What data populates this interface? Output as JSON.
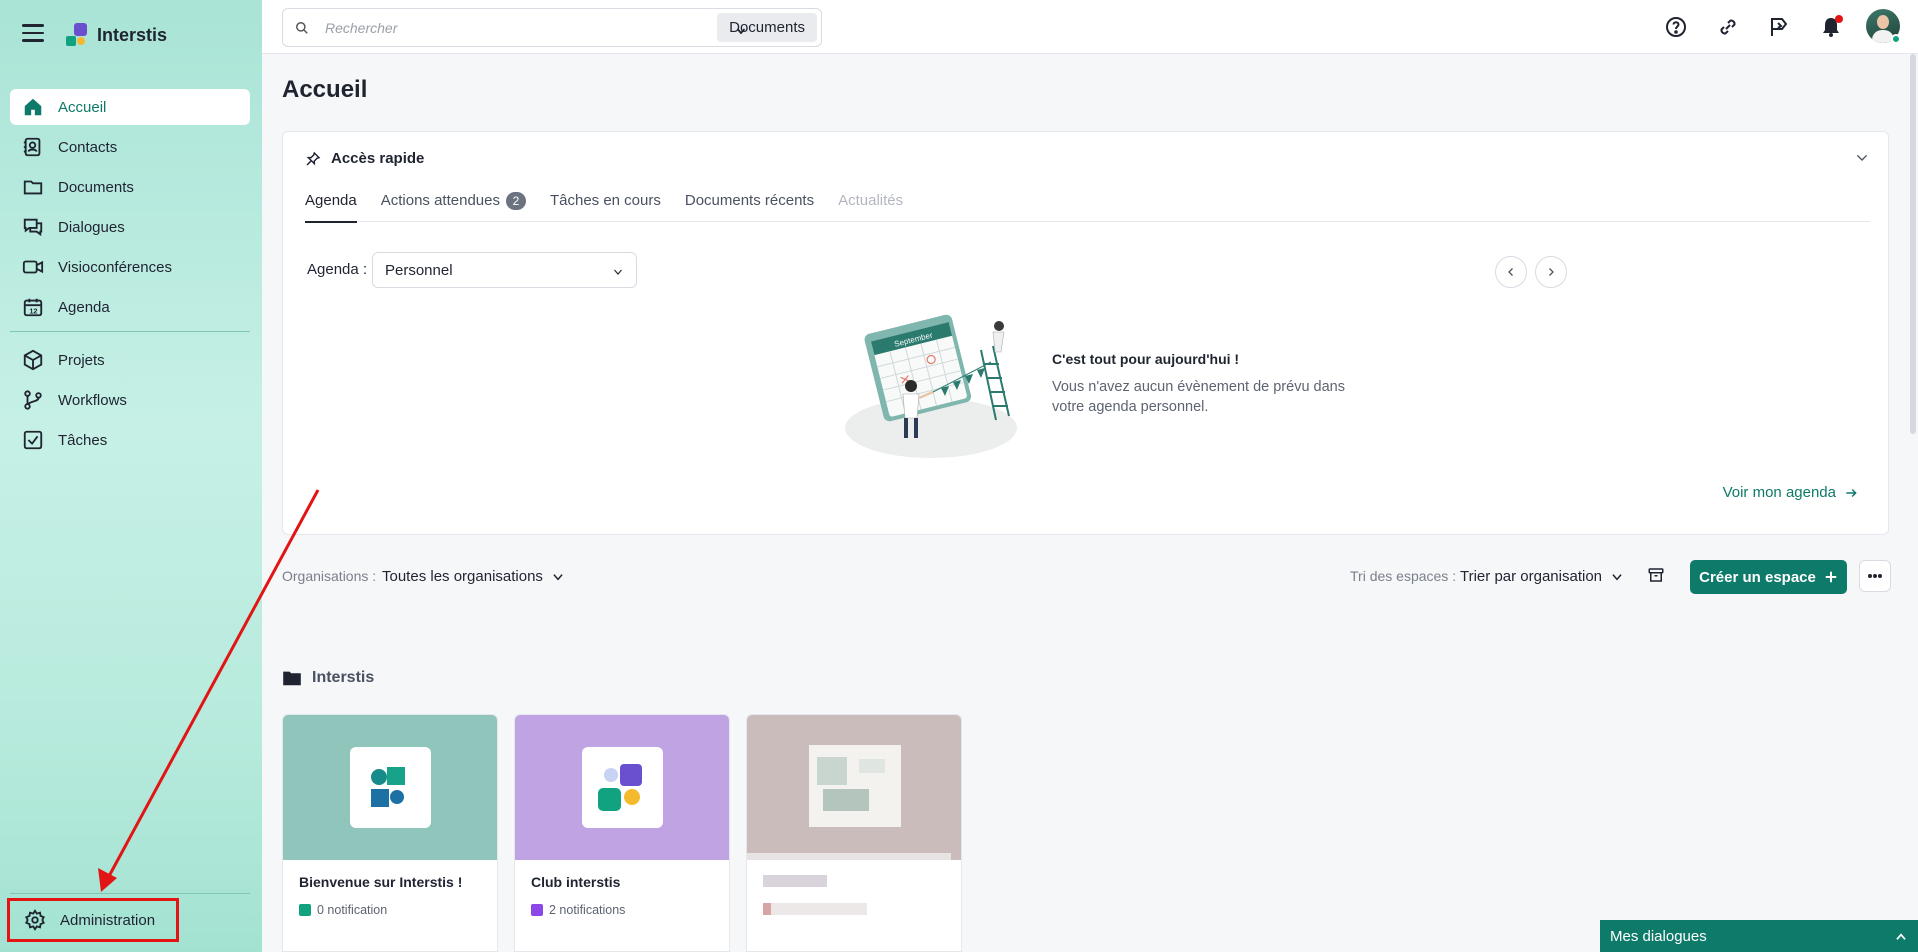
{
  "app": {
    "brand": "Interstis"
  },
  "sidebar": {
    "items": [
      {
        "label": "Accueil"
      },
      {
        "label": "Contacts"
      },
      {
        "label": "Documents"
      },
      {
        "label": "Dialogues"
      },
      {
        "label": "Visioconférences"
      },
      {
        "label": "Agenda"
      },
      {
        "label": "Projets"
      },
      {
        "label": "Workflows"
      },
      {
        "label": "Tâches"
      }
    ],
    "admin_label": "Administration"
  },
  "topbar": {
    "search_placeholder": "Rechercher",
    "search_scope": "Documents"
  },
  "main": {
    "title": "Accueil",
    "quick_access": {
      "title": "Accès rapide",
      "tabs": [
        {
          "label": "Agenda"
        },
        {
          "label": "Actions attendues",
          "badge": "2"
        },
        {
          "label": "Tâches en cours"
        },
        {
          "label": "Documents récents"
        },
        {
          "label": "Actualités"
        }
      ],
      "agenda_label": "Agenda :",
      "agenda_value": "Personnel",
      "empty_title": "C'est tout pour aujourd'hui !",
      "empty_text": "Vous n'avez aucun évènement de prévu dans votre agenda personnel.",
      "calendar_month": "September",
      "link": "Voir mon agenda"
    },
    "filters": {
      "org_label": "Organisations :",
      "org_value": "Toutes les organisations",
      "sort_label": "Tri des espaces :",
      "sort_value": "Trier par organisation",
      "create_label": "Créer un espace"
    },
    "section": {
      "title": "Interstis"
    },
    "spaces": [
      {
        "name": "Bienvenue sur Interstis !",
        "notifications": "0 notification",
        "cover_color": "#8fc5bb",
        "dot_color": "#11a37f"
      },
      {
        "name": "Club interstis",
        "notifications": "2 notifications",
        "cover_color": "#c0a3e2",
        "dot_color": "#8b47e8"
      },
      {
        "name": "",
        "notifications": "",
        "cover_color": "#cbbcbc",
        "dot_color": "#d8a5a5"
      }
    ]
  },
  "dialogues": {
    "label": "Mes dialogues"
  },
  "colors": {
    "accent": "#0e7a6a",
    "highlight": "#e21414"
  }
}
